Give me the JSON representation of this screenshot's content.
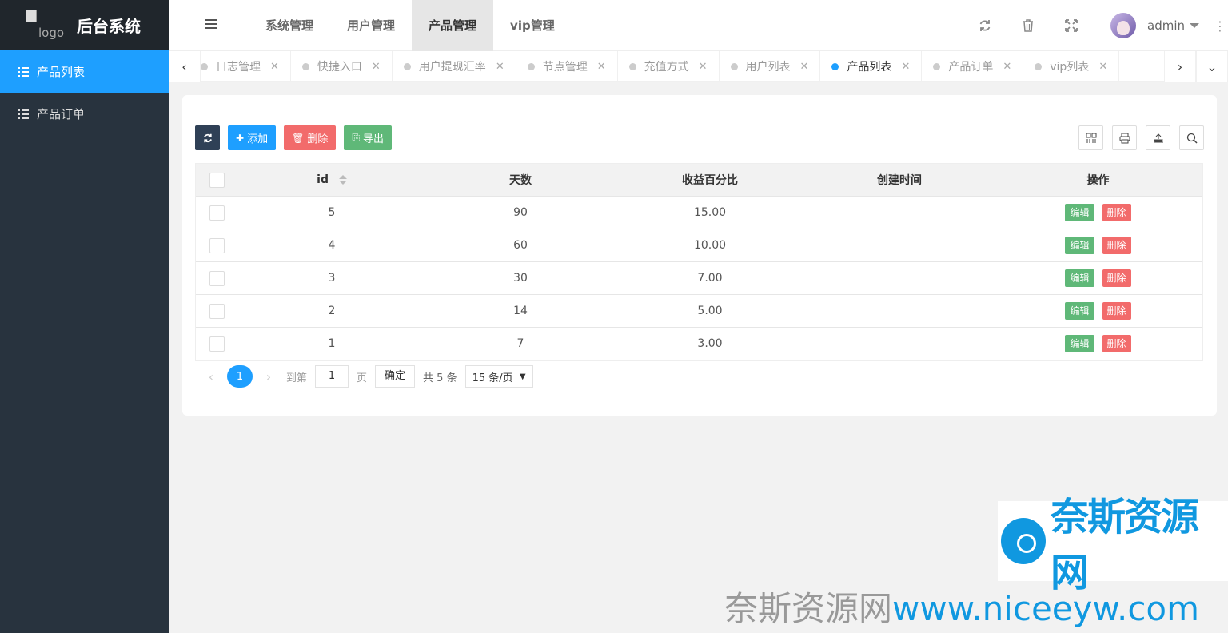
{
  "sidebar": {
    "logo_alt": "logo",
    "title": "后台系统",
    "items": [
      {
        "label": "产品列表",
        "active": true
      },
      {
        "label": "产品订单",
        "active": false
      }
    ]
  },
  "header": {
    "nav": [
      {
        "label": "系统管理"
      },
      {
        "label": "用户管理"
      },
      {
        "label": "产品管理"
      },
      {
        "label": "vip管理"
      }
    ],
    "active_nav": "产品管理",
    "icons": [
      "refresh-icon",
      "trash-icon",
      "fullscreen-icon"
    ],
    "user": "admin"
  },
  "tabs": [
    {
      "label": "日志管理",
      "active": false
    },
    {
      "label": "快捷入口",
      "active": false
    },
    {
      "label": "用户提现汇率",
      "active": false
    },
    {
      "label": "节点管理",
      "active": false
    },
    {
      "label": "充值方式",
      "active": false
    },
    {
      "label": "用户列表",
      "active": false
    },
    {
      "label": "产品列表",
      "active": true
    },
    {
      "label": "产品订单",
      "active": false
    },
    {
      "label": "vip列表",
      "active": false
    }
  ],
  "toolbar": {
    "add_label": "添加",
    "delete_label": "删除",
    "export_label": "导出"
  },
  "table": {
    "columns": [
      "id",
      "天数",
      "收益百分比",
      "创建时间",
      "操作"
    ],
    "rows": [
      {
        "id": "5",
        "days": "90",
        "pct": "15.00",
        "time": ""
      },
      {
        "id": "4",
        "days": "60",
        "pct": "10.00",
        "time": ""
      },
      {
        "id": "3",
        "days": "30",
        "pct": "7.00",
        "time": ""
      },
      {
        "id": "2",
        "days": "14",
        "pct": "5.00",
        "time": ""
      },
      {
        "id": "1",
        "days": "7",
        "pct": "3.00",
        "time": ""
      }
    ],
    "edit_label": "编辑",
    "delete_label": "删除"
  },
  "pagination": {
    "current": "1",
    "goto_label": "到第",
    "goto_value": "1",
    "page_label": "页",
    "confirm_label": "确定",
    "total": "共 5 条",
    "page_size": "15 条/页"
  },
  "watermark": {
    "brand": "奈斯资源网",
    "bottom_cn": "奈斯资源网",
    "bottom_url": "www.niceeyw.com"
  },
  "colors": {
    "sidebar_bg": "#28333e",
    "primary": "#1e9fff",
    "danger": "#f26b6b",
    "success": "#5fb878",
    "dark_btn": "#2f4056"
  }
}
